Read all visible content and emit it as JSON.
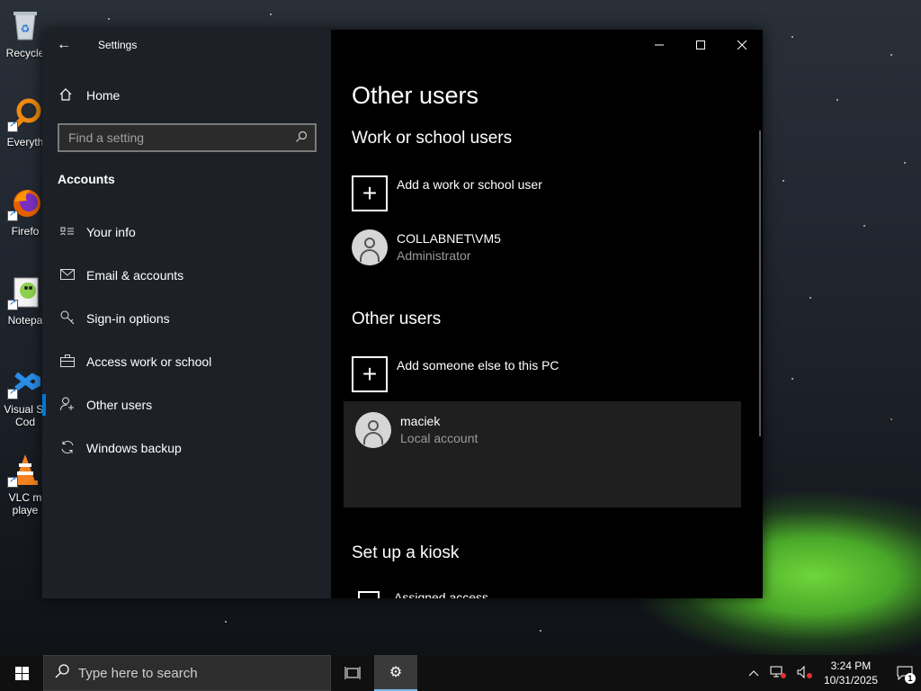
{
  "desktop": {
    "icons": [
      {
        "name": "Recycle Bin",
        "label": "Recycle"
      },
      {
        "name": "Everything",
        "label": "Everyth"
      },
      {
        "name": "Firefox",
        "label": "Firefo"
      },
      {
        "name": "Notepad++",
        "label": "Notepa"
      },
      {
        "name": "Visual Studio Code",
        "label": "Visual St\nCod"
      },
      {
        "name": "VLC media player",
        "label": "VLC m\nplaye"
      }
    ]
  },
  "window": {
    "app_title": "Settings",
    "caption": {
      "minimize": "—",
      "maximize": "☐",
      "close": "✕"
    }
  },
  "sidebar": {
    "home_label": "Home",
    "search_placeholder": "Find a setting",
    "section_heading": "Accounts",
    "items": [
      {
        "label": "Your info",
        "icon": "contact-card-icon"
      },
      {
        "label": "Email & accounts",
        "icon": "mail-icon"
      },
      {
        "label": "Sign-in options",
        "icon": "key-icon"
      },
      {
        "label": "Access work or school",
        "icon": "briefcase-icon"
      },
      {
        "label": "Other users",
        "icon": "person-add-icon",
        "active": true
      },
      {
        "label": "Windows backup",
        "icon": "sync-icon"
      }
    ]
  },
  "main": {
    "page_title": "Other users",
    "work_school": {
      "heading": "Work or school users",
      "add_label": "Add a work or school user",
      "users": [
        {
          "name": "COLLABNET\\VM5",
          "role": "Administrator"
        }
      ]
    },
    "other_users": {
      "heading": "Other users",
      "add_label": "Add someone else to this PC",
      "users": [
        {
          "name": "maciek",
          "role": "Local account"
        }
      ]
    },
    "kiosk": {
      "heading": "Set up a kiosk",
      "item_label": "Assigned access"
    }
  },
  "taskbar": {
    "search_placeholder": "Type here to search",
    "time": "3:24 PM",
    "date": "10/31/2025",
    "notification_count": "1"
  }
}
